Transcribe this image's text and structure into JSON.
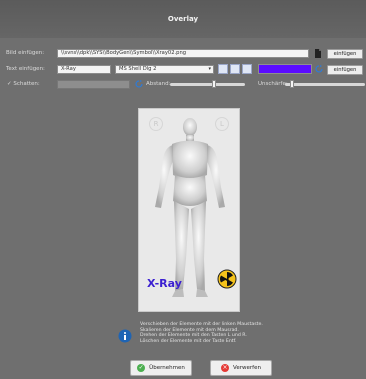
{
  "window": {
    "title": "Overlay"
  },
  "image_row": {
    "label": "Bild einfügen:",
    "path": "\\\\svns\\\\dpk\\\\SYS\\\\BodyGen\\\\Symbol\\\\Xray02.png",
    "button": "einfügen"
  },
  "text_row": {
    "label": "Text einfügen:",
    "value": "X-Ray",
    "font": "MS Shell Dlg 2",
    "color": "#5b0cff",
    "button": "einfügen"
  },
  "shadow_row": {
    "checkbox_label": "Schatten:",
    "distance_label": "Abstand:",
    "sharpness_label": "Unschärfe:"
  },
  "canvas": {
    "overlay_text": "X-Ray",
    "corner_left": "R",
    "corner_right": "L"
  },
  "info": {
    "lines": [
      "Verschieben der Elemente mit der linken Maustaste.",
      "Skalieren der Elemente mit dem Mausrad.",
      "Drehen der Elemente mit den Tasten L und R.",
      "Löschen der Elemente mit der Taste Entf."
    ]
  },
  "buttons": {
    "accept": "Übernehmen",
    "discard": "Verwerfen"
  },
  "colors": {
    "accept_icon": "#4caf50",
    "discard_icon": "#e53935",
    "info_icon": "#1e64b4",
    "text_color": "#5b0cff"
  }
}
